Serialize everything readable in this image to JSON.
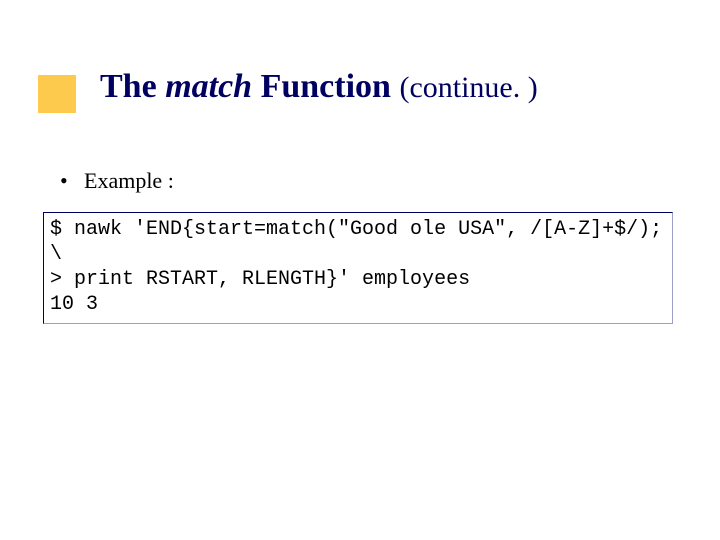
{
  "title": {
    "pre": "The ",
    "emph": "match",
    "post": " Function ",
    "cont": "(continue. )"
  },
  "bullet": {
    "label": "Example :"
  },
  "code": {
    "line1": "$ nawk 'END{start=match(\"Good ole USA\", /[A-Z]+$/); \\",
    "line2": "> print RSTART, RLENGTH}' employees",
    "line3": "10 3"
  }
}
